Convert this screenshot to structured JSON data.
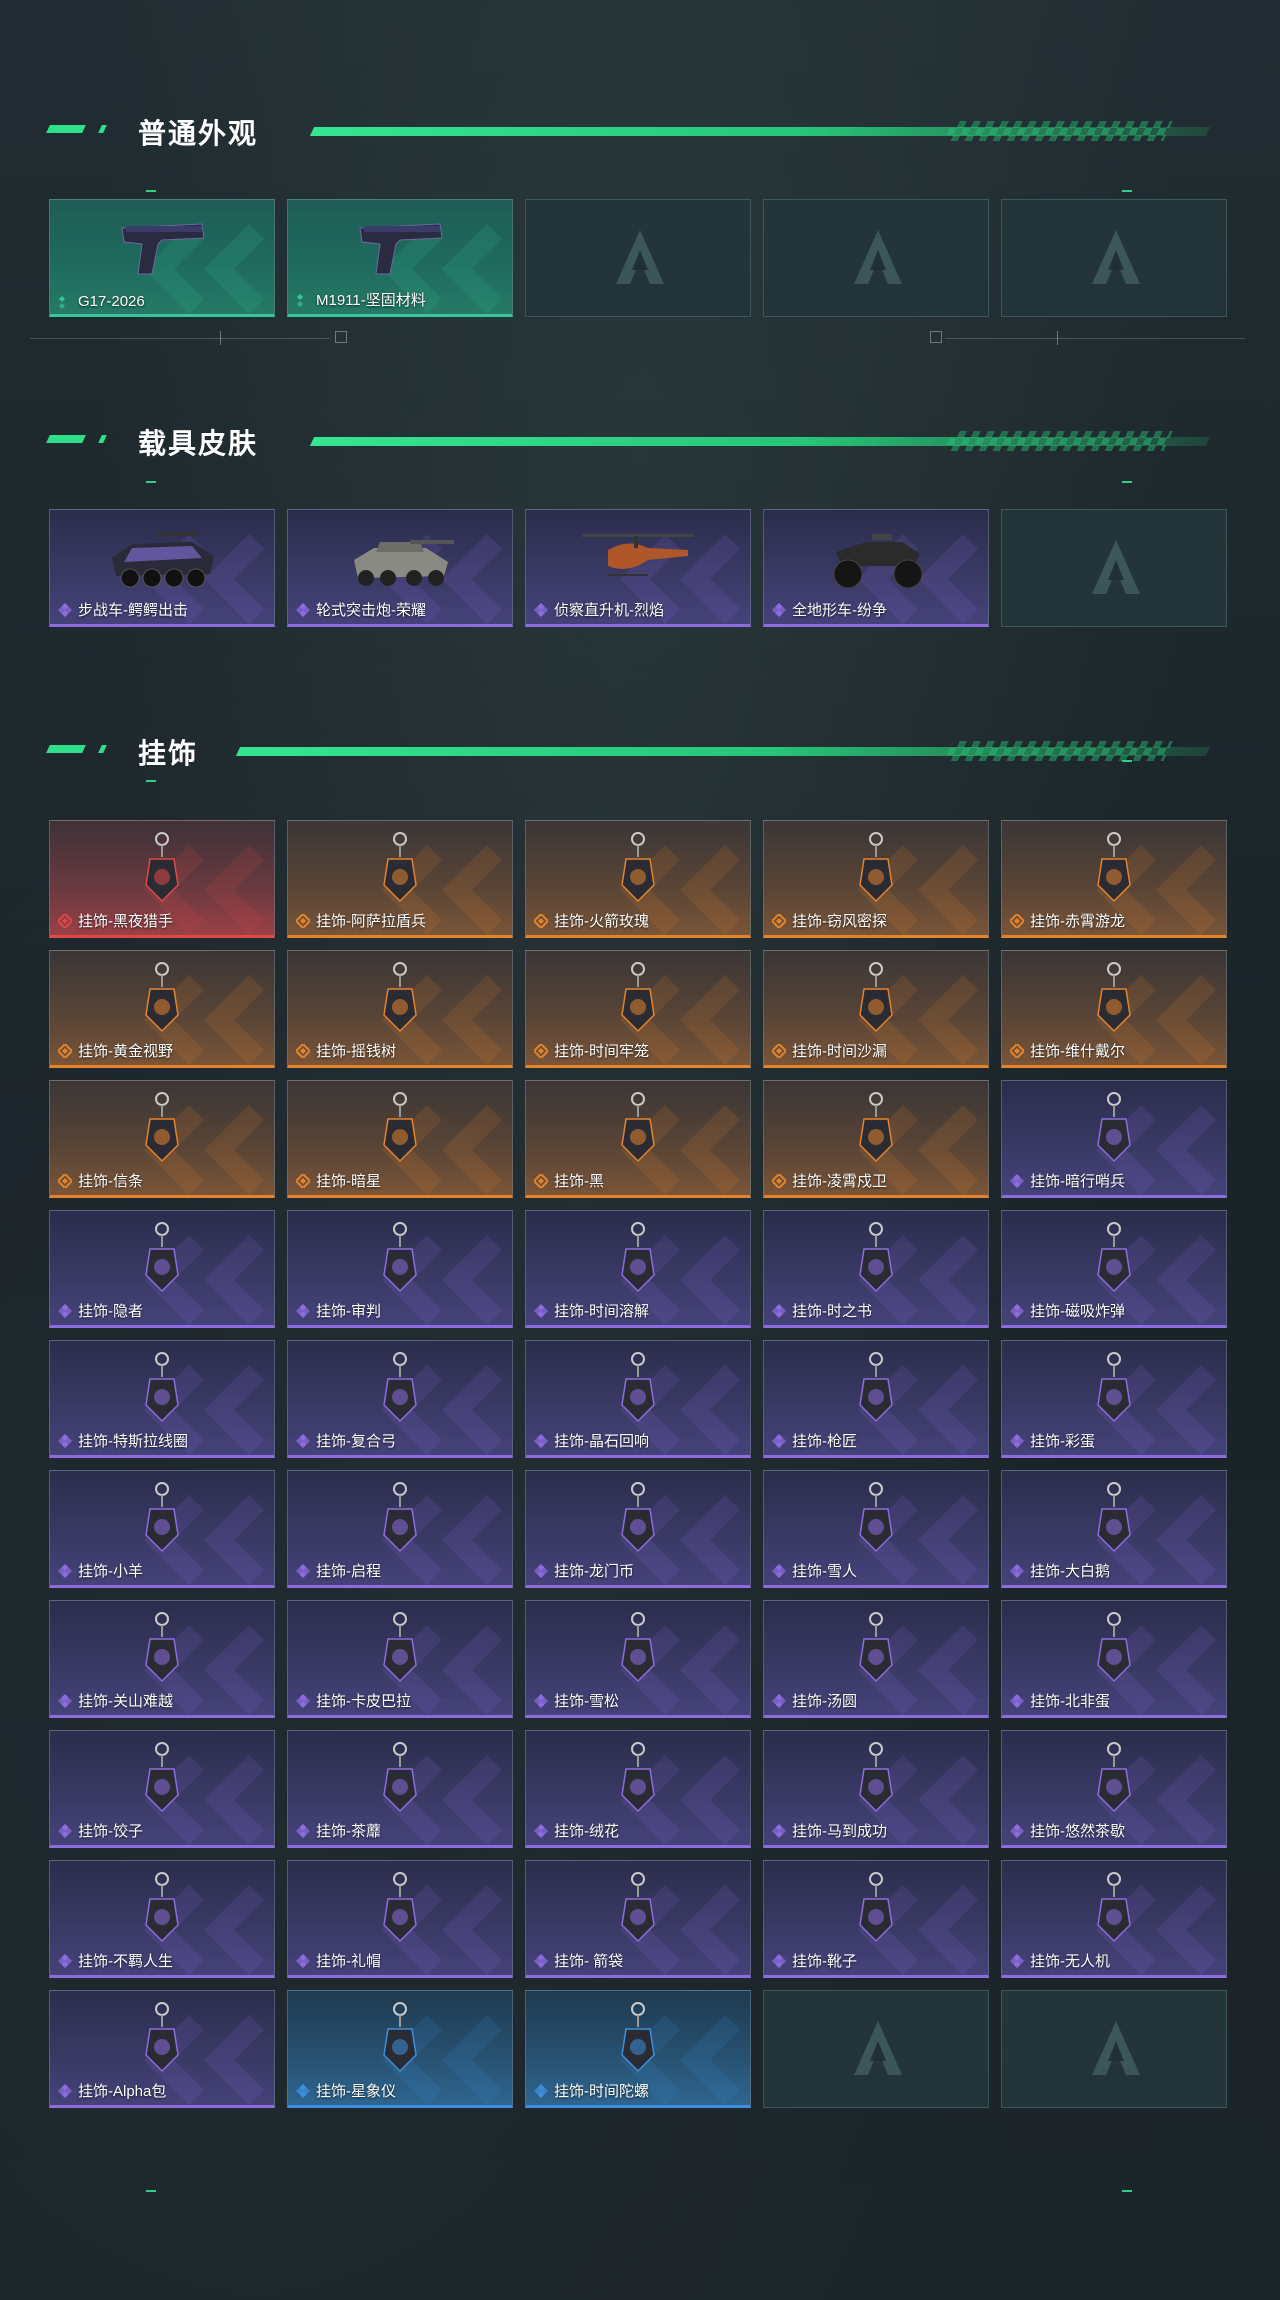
{
  "sections": {
    "skins": {
      "title": "普通外观",
      "items": [
        {
          "name": "G17-2026",
          "rarity": "green",
          "icon": "pistol-icon"
        },
        {
          "name": "M1911-坚固材料",
          "rarity": "green",
          "icon": "pistol-icon"
        }
      ]
    },
    "vehicles": {
      "title": "载具皮肤",
      "items": [
        {
          "name": "步战车-鳄鳄出击",
          "rarity": "purple",
          "icon": "armored-vehicle-icon"
        },
        {
          "name": "轮式突击炮-荣耀",
          "rarity": "purple",
          "icon": "tank-icon"
        },
        {
          "name": "侦察直升机-烈焰",
          "rarity": "purple",
          "icon": "helicopter-icon"
        },
        {
          "name": "全地形车-纷争",
          "rarity": "purple",
          "icon": "atv-icon"
        }
      ]
    },
    "charms": {
      "title": "挂饰",
      "items": [
        {
          "name": "挂饰-黑夜猎手",
          "rarity": "red"
        },
        {
          "name": "挂饰-阿萨拉盾兵",
          "rarity": "orange"
        },
        {
          "name": "挂饰-火箭玫瑰",
          "rarity": "orange"
        },
        {
          "name": "挂饰-窃风密探",
          "rarity": "orange"
        },
        {
          "name": "挂饰-赤霄游龙",
          "rarity": "orange"
        },
        {
          "name": "挂饰-黄金视野",
          "rarity": "orange"
        },
        {
          "name": "挂饰-摇钱树",
          "rarity": "orange"
        },
        {
          "name": "挂饰-时间牢笼",
          "rarity": "orange"
        },
        {
          "name": "挂饰-时间沙漏",
          "rarity": "orange"
        },
        {
          "name": "挂饰-维什戴尔",
          "rarity": "orange"
        },
        {
          "name": "挂饰-信条",
          "rarity": "orange"
        },
        {
          "name": "挂饰-暗星",
          "rarity": "orange"
        },
        {
          "name": "挂饰-黑",
          "rarity": "orange"
        },
        {
          "name": "挂饰-凌霄戍卫",
          "rarity": "orange"
        },
        {
          "name": "挂饰-暗行哨兵",
          "rarity": "purple"
        },
        {
          "name": "挂饰-隐者",
          "rarity": "purple"
        },
        {
          "name": "挂饰-审判",
          "rarity": "purple"
        },
        {
          "name": "挂饰-时间溶解",
          "rarity": "purple"
        },
        {
          "name": "挂饰-时之书",
          "rarity": "purple"
        },
        {
          "name": "挂饰-磁吸炸弹",
          "rarity": "purple"
        },
        {
          "name": "挂饰-特斯拉线圈",
          "rarity": "purple"
        },
        {
          "name": "挂饰-复合弓",
          "rarity": "purple"
        },
        {
          "name": "挂饰-晶石回响",
          "rarity": "purple"
        },
        {
          "name": "挂饰-枪匠",
          "rarity": "purple"
        },
        {
          "name": "挂饰-彩蛋",
          "rarity": "purple"
        },
        {
          "name": "挂饰-小羊",
          "rarity": "purple"
        },
        {
          "name": "挂饰-启程",
          "rarity": "purple"
        },
        {
          "name": "挂饰-龙门币",
          "rarity": "purple"
        },
        {
          "name": "挂饰-雪人",
          "rarity": "purple"
        },
        {
          "name": "挂饰-大白鹅",
          "rarity": "purple"
        },
        {
          "name": "挂饰-关山难越",
          "rarity": "purple"
        },
        {
          "name": "挂饰-卡皮巴拉",
          "rarity": "purple"
        },
        {
          "name": "挂饰-雪松",
          "rarity": "purple"
        },
        {
          "name": "挂饰-汤圆",
          "rarity": "purple"
        },
        {
          "name": "挂饰-北非蛋",
          "rarity": "purple"
        },
        {
          "name": "挂饰-饺子",
          "rarity": "purple"
        },
        {
          "name": "挂饰-茶蘼",
          "rarity": "purple"
        },
        {
          "name": "挂饰-绒花",
          "rarity": "purple"
        },
        {
          "name": "挂饰-马到成功",
          "rarity": "purple"
        },
        {
          "name": "挂饰-悠然茶歇",
          "rarity": "purple"
        },
        {
          "name": "挂饰-不羁人生",
          "rarity": "purple"
        },
        {
          "name": "挂饰-礼帽",
          "rarity": "purple"
        },
        {
          "name": "挂饰- 箭袋",
          "rarity": "purple"
        },
        {
          "name": "挂饰-靴子",
          "rarity": "purple"
        },
        {
          "name": "挂饰-无人机",
          "rarity": "purple"
        },
        {
          "name": "挂饰-Alpha包",
          "rarity": "purple"
        },
        {
          "name": "挂饰-星象仪",
          "rarity": "blue"
        },
        {
          "name": "挂饰-时间陀螺",
          "rarity": "blue"
        }
      ]
    }
  },
  "colors": {
    "accent": "#2fe08a",
    "green": "#36c79b",
    "purple": "#8d6ce0",
    "orange": "#e5832d",
    "red": "#e04848",
    "blue": "#3d8fdc"
  }
}
